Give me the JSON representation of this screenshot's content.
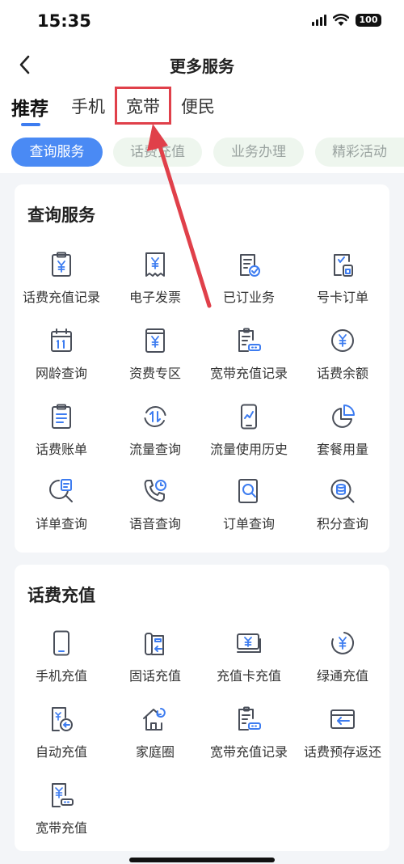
{
  "status_bar": {
    "time": "15:35",
    "battery": "100"
  },
  "nav": {
    "title": "更多服务"
  },
  "tabs": [
    {
      "label": "推荐"
    },
    {
      "label": "手机"
    },
    {
      "label": "宽带"
    },
    {
      "label": "便民"
    }
  ],
  "chips": [
    {
      "label": "查询服务"
    },
    {
      "label": "话费充值"
    },
    {
      "label": "业务办理"
    },
    {
      "label": "精彩活动"
    }
  ],
  "sections": [
    {
      "title": "查询服务",
      "items": [
        {
          "label": "话费充值记录",
          "icon": "bill-record-icon"
        },
        {
          "label": "电子发票",
          "icon": "invoice-icon"
        },
        {
          "label": "已订业务",
          "icon": "subscribed-icon"
        },
        {
          "label": "号卡订单",
          "icon": "sim-order-icon"
        },
        {
          "label": "网龄查询",
          "icon": "calendar-icon"
        },
        {
          "label": "资费专区",
          "icon": "tariff-icon"
        },
        {
          "label": "宽带充值记录",
          "icon": "broadband-record-icon"
        },
        {
          "label": "话费余额",
          "icon": "balance-icon"
        },
        {
          "label": "话费账单",
          "icon": "bill-icon"
        },
        {
          "label": "流量查询",
          "icon": "data-usage-icon"
        },
        {
          "label": "流量使用历史",
          "icon": "data-history-icon"
        },
        {
          "label": "套餐用量",
          "icon": "package-usage-icon"
        },
        {
          "label": "详单查询",
          "icon": "detail-search-icon"
        },
        {
          "label": "语音查询",
          "icon": "voice-search-icon"
        },
        {
          "label": "订单查询",
          "icon": "order-search-icon"
        },
        {
          "label": "积分查询",
          "icon": "points-search-icon"
        }
      ]
    },
    {
      "title": "话费充值",
      "items": [
        {
          "label": "手机充值",
          "icon": "phone-recharge-icon"
        },
        {
          "label": "固话充值",
          "icon": "landline-recharge-icon"
        },
        {
          "label": "充值卡充值",
          "icon": "card-recharge-icon"
        },
        {
          "label": "绿通充值",
          "icon": "green-recharge-icon"
        },
        {
          "label": "自动充值",
          "icon": "auto-recharge-icon"
        },
        {
          "label": "家庭圈",
          "icon": "family-icon"
        },
        {
          "label": "宽带充值记录",
          "icon": "broadband-record-icon"
        },
        {
          "label": "话费预存返还",
          "icon": "prepay-refund-icon"
        },
        {
          "label": "宽带充值",
          "icon": "broadband-recharge-icon"
        }
      ]
    }
  ],
  "colors": {
    "accent": "#4a8af4",
    "highlight": "#e0404a",
    "icon": "#4a4f5a"
  }
}
